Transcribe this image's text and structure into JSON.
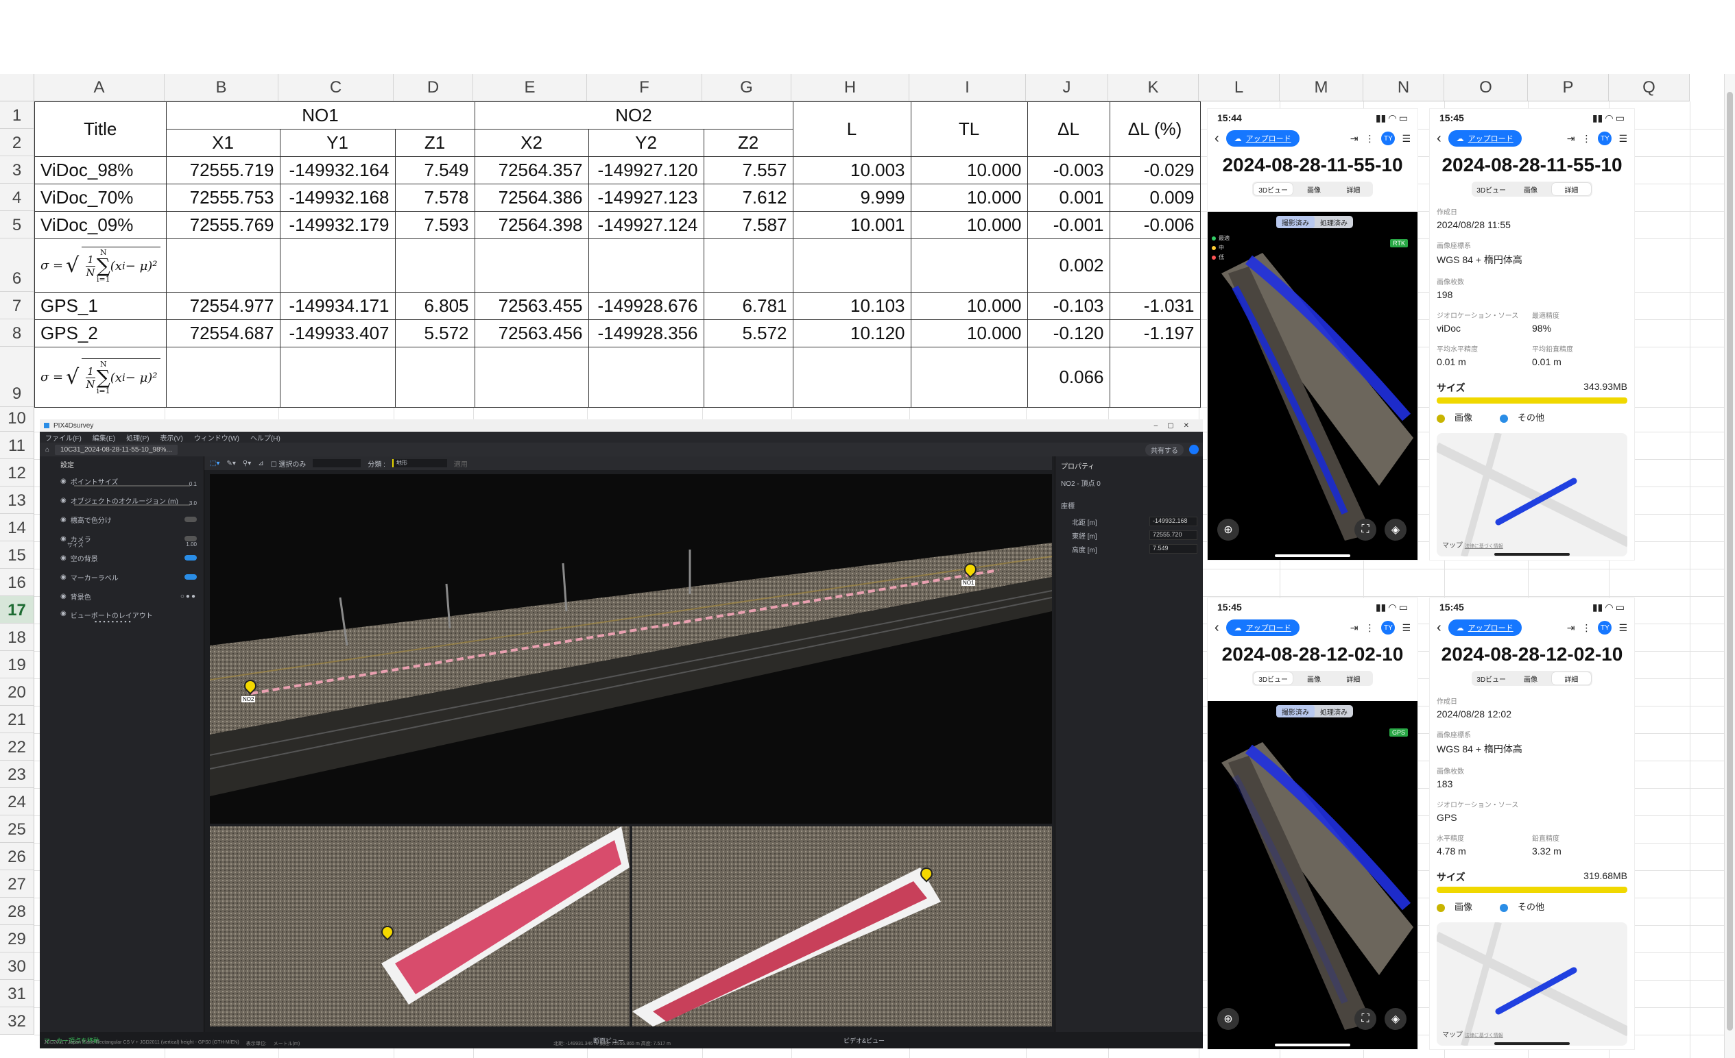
{
  "sheet": {
    "columns": [
      "A",
      "B",
      "C",
      "D",
      "E",
      "F",
      "G",
      "H",
      "I",
      "J",
      "K",
      "L",
      "M",
      "N",
      "O",
      "P",
      "Q"
    ],
    "rows": [
      "1",
      "2",
      "3",
      "4",
      "5",
      "6",
      "7",
      "8",
      "9",
      "10",
      "11",
      "12",
      "13",
      "14",
      "15",
      "16",
      "17",
      "18",
      "19",
      "20",
      "21",
      "22",
      "23",
      "24",
      "25",
      "26",
      "27",
      "28",
      "29",
      "30",
      "31",
      "32"
    ],
    "selected_row": "17"
  },
  "table": {
    "title": "Title",
    "no1": "NO1",
    "no2": "NO2",
    "L": "L",
    "TL": "TL",
    "dL": "ΔL",
    "dLpct": "ΔL (%)",
    "sub": [
      "X1",
      "Y1",
      "Z1",
      "X2",
      "Y2",
      "Z2"
    ],
    "formula": {
      "lhs": "σ =",
      "num": "1",
      "den": "N",
      "top": "N",
      "bot": "i=1",
      "body": "(x",
      "sub": "i",
      "tail": " − μ)²"
    },
    "rows": [
      {
        "name": "ViDoc_98%",
        "x1": "72555.719",
        "y1": "-149932.164",
        "z1": "7.549",
        "x2": "72564.357",
        "y2": "-149927.120",
        "z2": "7.557",
        "L": "10.003",
        "TL": "10.000",
        "dL": "-0.003",
        "pct": "-0.029"
      },
      {
        "name": "ViDoc_70%",
        "x1": "72555.753",
        "y1": "-149932.168",
        "z1": "7.578",
        "x2": "72564.386",
        "y2": "-149927.123",
        "z2": "7.612",
        "L": "9.999",
        "TL": "10.000",
        "dL": "0.001",
        "pct": "0.009"
      },
      {
        "name": "ViDoc_09%",
        "x1": "72555.769",
        "y1": "-149932.179",
        "z1": "7.593",
        "x2": "72564.398",
        "y2": "-149927.124",
        "z2": "7.587",
        "L": "10.001",
        "TL": "10.000",
        "dL": "-0.001",
        "pct": "-0.006"
      },
      {
        "name": "GPS_1",
        "x1": "72554.977",
        "y1": "-149934.171",
        "z1": "6.805",
        "x2": "72563.455",
        "y2": "-149928.676",
        "z2": "6.781",
        "L": "10.103",
        "TL": "10.000",
        "dL": "-0.103",
        "pct": "-1.031"
      },
      {
        "name": "GPS_2",
        "x1": "72554.687",
        "y1": "-149933.407",
        "z1": "5.572",
        "x2": "72563.456",
        "y2": "-149928.356",
        "z2": "5.572",
        "L": "10.120",
        "TL": "10.000",
        "dL": "-0.120",
        "pct": "-1.197"
      }
    ],
    "sigma1": "0.002",
    "sigma2": "0.066"
  },
  "pix": {
    "app": "PIX4Dsurvey",
    "menu": [
      "ファイル(F)",
      "編集(E)",
      "処理(P)",
      "表示(V)",
      "ウィンドウ(W)",
      "ヘルプ(H)"
    ],
    "tab": "10C31_2024-08-28-11-55-10_98%...",
    "share": "共有する",
    "left_title": "設定",
    "left_items": [
      "ポイントサイズ",
      "オブジェクトのオクルージョン (m)",
      "標高で色分け",
      "カメラ",
      "空の背景",
      "マーカーラベル",
      "背景色",
      "ビューポートのレイアウト"
    ],
    "slider_vals": [
      "0.1",
      "3.0"
    ],
    "camera_size_label": "サイズ",
    "camera_size_val": "1.00",
    "toolbar_select": "選択のみ",
    "toolbar_cls": "分類 :",
    "toolbar_cls_val": "地形",
    "toolbar_apply": "適用",
    "right_title": "プロパティ",
    "marker": "NO2 - 頂点 0",
    "coord_title": "座標",
    "coords": [
      {
        "k": "北距 [m]",
        "v": "-149932.168"
      },
      {
        "k": "東経 [m]",
        "v": "72555.720"
      },
      {
        "k": "高度 [m]",
        "v": "7.549"
      }
    ],
    "pin_no1": "NO1",
    "pin_no2": "NO2",
    "status_left": "マーカー頂点を移動",
    "status_mid": "断面ビュー",
    "status_right": "ビデオ&ビュー",
    "crs": "JGD2011 / Japan Plane Rectangular CS V + JGD2011 (vertical) height - GPS0 (GTH-M/EN)",
    "unit_label": "表示単位:",
    "unit": "メートル(m)",
    "cursor": "北距: -149931.346 m  東経: 72556.865 m  高度: 7.517 m"
  },
  "phones": [
    {
      "time": "15:44",
      "upload": "アップロード",
      "title": "2024-08-28-11-55-10",
      "tabs": [
        "3Dビュー",
        "画像",
        "詳細"
      ],
      "active": 0,
      "pc_tabs": [
        "撮影済み",
        "処理済み"
      ],
      "badge": "RTK",
      "legend": [
        "最適",
        "中",
        "低"
      ]
    },
    {
      "time": "15:45",
      "upload": "アップロード",
      "title": "2024-08-28-11-55-10",
      "tabs": [
        "3Dビュー",
        "画像",
        "詳細"
      ],
      "active": 2,
      "details": [
        {
          "k": "作成日",
          "v": "2024/08/28 11:55"
        },
        {
          "k": "画像座標系",
          "v": "WGS 84 + 楕円体高"
        },
        {
          "k": "画像枚数",
          "v": "198"
        }
      ],
      "pair1": [
        {
          "k": "ジオロケーション・ソース",
          "v": "viDoc"
        },
        {
          "k": "最適精度",
          "v": "98%"
        }
      ],
      "pair2": [
        {
          "k": "平均水平精度",
          "v": "0.01 m"
        },
        {
          "k": "平均鉛直精度",
          "v": "0.01 m"
        }
      ],
      "size_label": "サイズ",
      "size": "343.93MB",
      "leg1": "画像",
      "leg2": "その他",
      "map": "マップ",
      "map_link": "法律に基づく情報"
    },
    {
      "time": "15:45",
      "upload": "アップロード",
      "title": "2024-08-28-12-02-10",
      "tabs": [
        "3Dビュー",
        "画像",
        "詳細"
      ],
      "active": 0,
      "pc_tabs": [
        "撮影済み",
        "処理済み"
      ],
      "badge": "GPS"
    },
    {
      "time": "15:45",
      "upload": "アップロード",
      "title": "2024-08-28-12-02-10",
      "tabs": [
        "3Dビュー",
        "画像",
        "詳細"
      ],
      "active": 2,
      "details": [
        {
          "k": "作成日",
          "v": "2024/08/28 12:02"
        },
        {
          "k": "画像座標系",
          "v": "WGS 84 + 楕円体高"
        },
        {
          "k": "画像枚数",
          "v": "183"
        }
      ],
      "pair1": [
        {
          "k": "ジオロケーション・ソース",
          "v": "GPS"
        },
        {
          "k": "",
          "v": ""
        }
      ],
      "pair2": [
        {
          "k": "水平精度",
          "v": "4.78 m"
        },
        {
          "k": "鉛直精度",
          "v": "3.32 m"
        }
      ],
      "size_label": "サイズ",
      "size": "319.68MB",
      "leg1": "画像",
      "leg2": "その他",
      "map": "マップ",
      "map_link": "法律に基づく情報"
    }
  ]
}
